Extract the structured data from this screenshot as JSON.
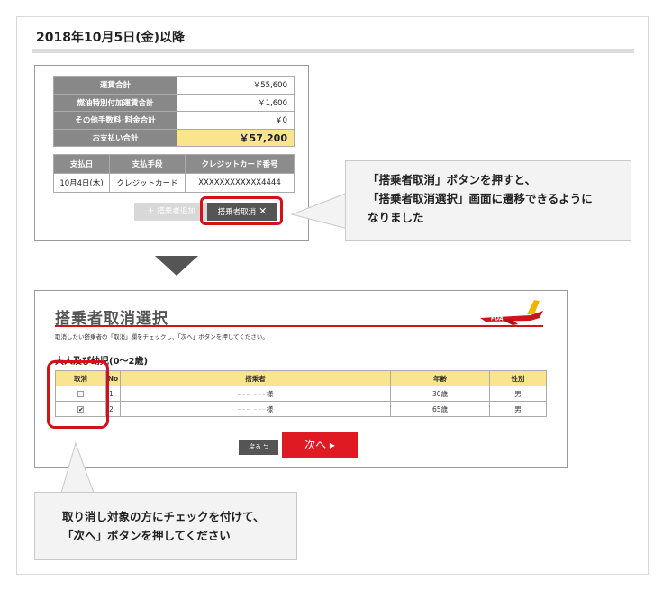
{
  "heading": "2018年10月5日(金)以降",
  "fare_summary": {
    "rows": [
      {
        "label": "運賃合計",
        "value": "￥55,600"
      },
      {
        "label": "燃油特別付加運賃合計",
        "value": "￥1,600"
      },
      {
        "label": "その他手数料･料金合計",
        "value": "￥0"
      },
      {
        "label": "お支払い合計",
        "value": "￥57,200"
      }
    ]
  },
  "payment_table": {
    "headers": [
      "支払日",
      "支払手段",
      "クレジットカード番号"
    ],
    "row": [
      "10月4日(木)",
      "クレジットカード",
      "XXXXXXXXXXXX4444"
    ]
  },
  "buttons1": {
    "add_label": "＋ 搭乗者追加",
    "cancel_label": "搭乗者取消",
    "cancel_icon": "✕"
  },
  "callout1": {
    "line1": "「搭乗者取消」ボタンを押すと、",
    "line2": "「搭乗者取消選択」画面に遷移できるように",
    "line3": "なりました"
  },
  "screen2": {
    "title": "搭乗者取消選択",
    "plane_logo": "FDA",
    "instruction": "取消したい搭乗者の「取消」欄をチェックし、「次へ」ボタンを押してください。",
    "section": "大人及び幼児(0〜2歳)",
    "headers": [
      "取消",
      "No",
      "搭乗者",
      "年齢",
      "性別"
    ],
    "rows": [
      {
        "checked": "",
        "no": "1",
        "name_blur": "ｰｰｰ ｰｰｰ",
        "name_suffix": "様",
        "age": "30歳",
        "sex": "男"
      },
      {
        "checked": "✔",
        "no": "2",
        "name_blur": "ｰｰｰ ｰｰｰ",
        "name_suffix": "様",
        "age": "65歳",
        "sex": "男"
      }
    ],
    "back_label": "戻る ⮌",
    "next_label": "次へ ▸"
  },
  "callout2": {
    "line1": "取り消し対象の方にチェックを付けて、",
    "line2": "「次へ」ボタンを押してください"
  },
  "colors": {
    "highlight": "#d0121b",
    "total_bg": "#fbe48e",
    "next_button": "#e01a22"
  }
}
